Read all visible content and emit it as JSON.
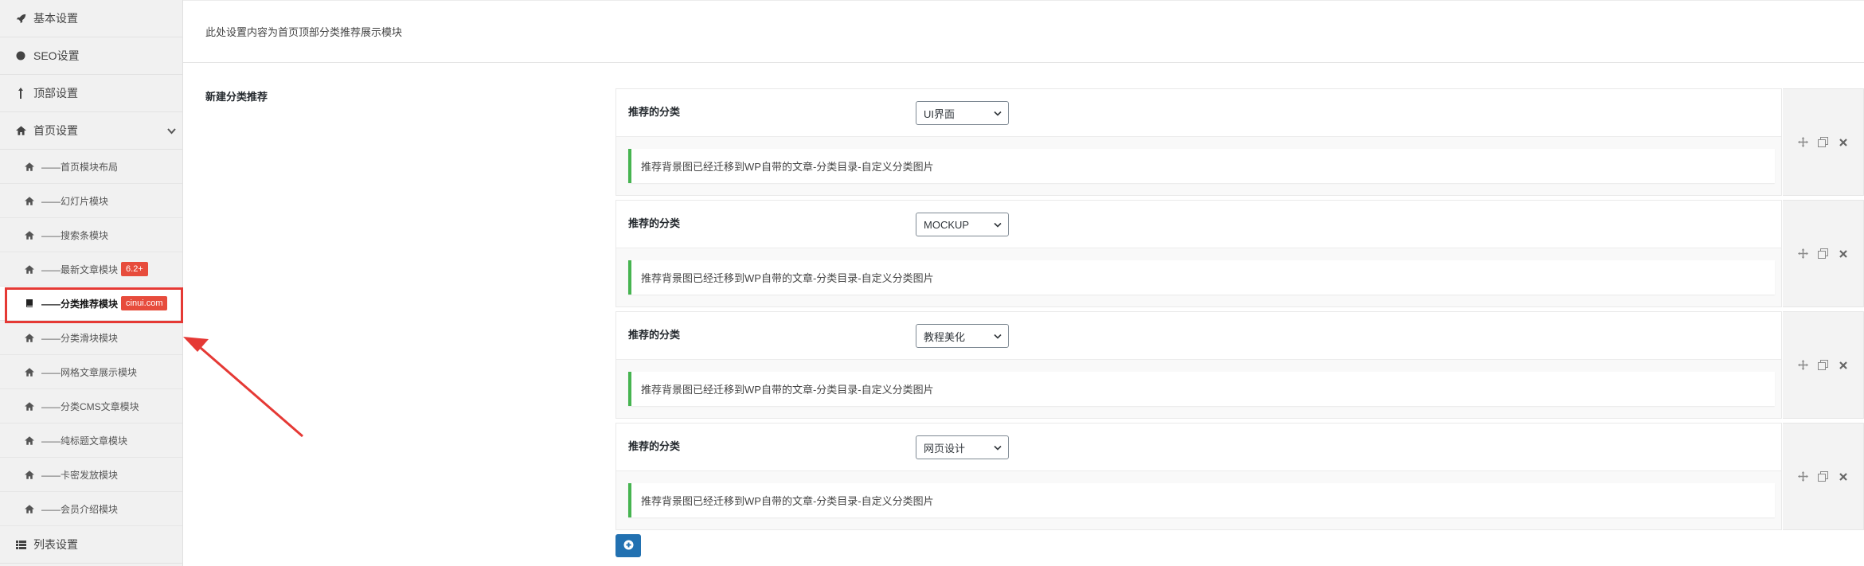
{
  "sidebar": {
    "items": [
      {
        "label": "基本设置",
        "icon": "rocket-icon"
      },
      {
        "label": "SEO设置",
        "icon": "circle-icon"
      },
      {
        "label": "顶部设置",
        "icon": "arrow-up-icon"
      },
      {
        "label": "首页设置",
        "icon": "home-icon",
        "expanded": true
      }
    ],
    "sub_items": [
      {
        "label": "——首页模块布局",
        "icon": "home-icon"
      },
      {
        "label": "——幻灯片模块",
        "icon": "home-icon"
      },
      {
        "label": "——搜索条模块",
        "icon": "home-icon"
      },
      {
        "label": "——最新文章模块",
        "icon": "home-icon",
        "badge": "6.2+"
      },
      {
        "label": "——分类推荐模块",
        "icon": "book-icon",
        "badge": "cinui.com",
        "active": true
      },
      {
        "label": "——分类滑块模块",
        "icon": "home-icon"
      },
      {
        "label": "——网格文章展示模块",
        "icon": "home-icon"
      },
      {
        "label": "——分类CMS文章模块",
        "icon": "home-icon"
      },
      {
        "label": "——纯标题文章模块",
        "icon": "home-icon"
      },
      {
        "label": "——卡密发放模块",
        "icon": "home-icon"
      },
      {
        "label": "——会员介绍模块",
        "icon": "home-icon"
      }
    ],
    "bottom_item": {
      "label": "列表设置",
      "icon": "list-icon"
    }
  },
  "section": {
    "description": "此处设置内容为首页顶部分类推荐展示模块",
    "field_title": "新建分类推荐"
  },
  "groups": [
    {
      "label": "推荐的分类",
      "selected": "UI界面",
      "notice": "推荐背景图已经迁移到WP自带的文章-分类目录-自定义分类图片"
    },
    {
      "label": "推荐的分类",
      "selected": "MOCKUP",
      "notice": "推荐背景图已经迁移到WP自带的文章-分类目录-自定义分类图片"
    },
    {
      "label": "推荐的分类",
      "selected": "教程美化",
      "notice": "推荐背景图已经迁移到WP自带的文章-分类目录-自定义分类图片"
    },
    {
      "label": "推荐的分类",
      "selected": "网页设计",
      "notice": "推荐背景图已经迁移到WP自带的文章-分类目录-自定义分类图片"
    }
  ],
  "colors": {
    "accent": "#2271b1",
    "notice_border": "#46b450",
    "badge": "#e74c3c",
    "highlight": "#e53935"
  }
}
